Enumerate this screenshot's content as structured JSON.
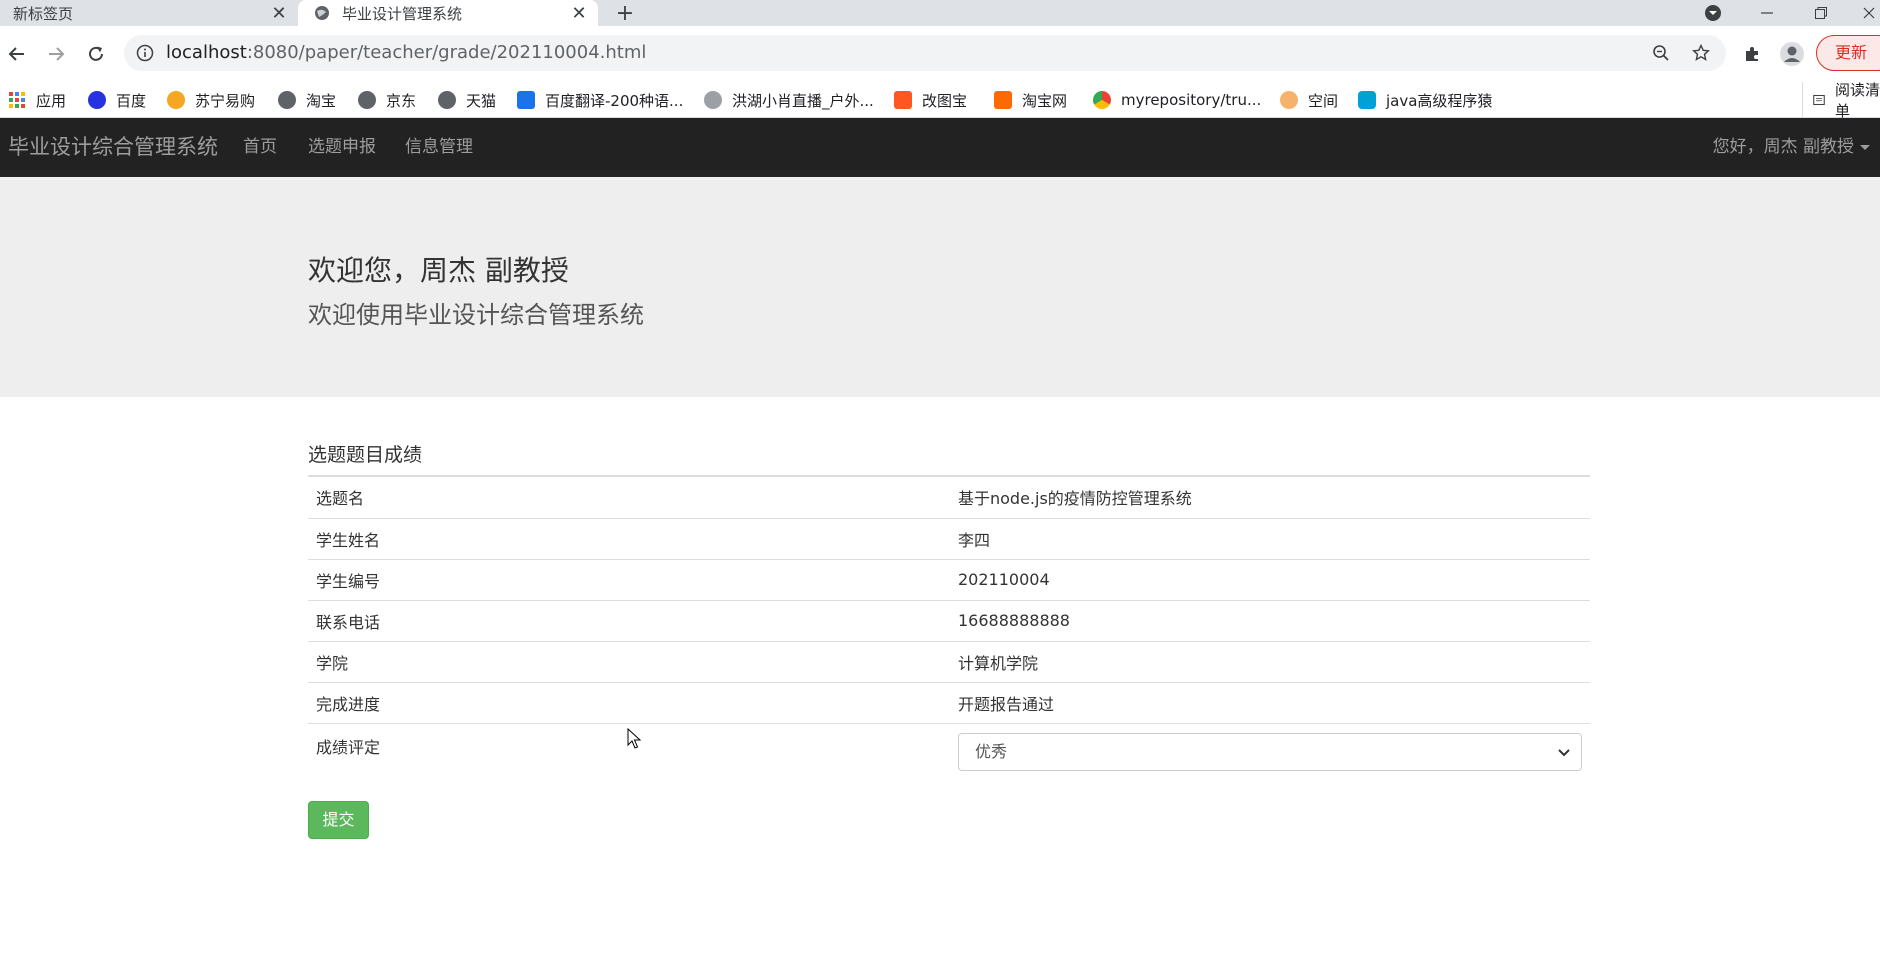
{
  "browser": {
    "tabs": [
      {
        "title": "新标签页"
      },
      {
        "title": "毕业设计管理系统"
      }
    ],
    "url_host": "localhost",
    "url_rest": ":8080/paper/teacher/grade/202110004.html",
    "update_label": "更新",
    "reading_list_label": "阅读清单",
    "bookmarks": [
      {
        "label": "应用",
        "icon": "apps-grid-icon",
        "color": "#ea4335"
      },
      {
        "label": "百度",
        "icon": "baidu-paw-icon",
        "color": "#2932e1"
      },
      {
        "label": "苏宁易购",
        "icon": "suning-icon",
        "color": "#f5a623"
      },
      {
        "label": "淘宝",
        "icon": "globe-icon",
        "color": "#5f6368"
      },
      {
        "label": "京东",
        "icon": "globe-icon",
        "color": "#5f6368"
      },
      {
        "label": "天猫",
        "icon": "globe-icon",
        "color": "#5f6368"
      },
      {
        "label": "百度翻译-200种语...",
        "icon": "translate-icon",
        "color": "#1a73e8"
      },
      {
        "label": "洪湖小肖直播_户外...",
        "icon": "bird-icon",
        "color": "#9aa0a6"
      },
      {
        "label": "改图宝",
        "icon": "gaitubao-icon",
        "color": "#ff5722"
      },
      {
        "label": "淘宝网",
        "icon": "taobao-icon",
        "color": "#ff6a00"
      },
      {
        "label": "myrepository/tru...",
        "icon": "chrome-icon",
        "color": "#34a853"
      },
      {
        "label": "空间",
        "icon": "qzone-icon",
        "color": "#f6b26b"
      },
      {
        "label": "java高级程序猿",
        "icon": "bilibili-icon",
        "color": "#00a1d6"
      }
    ]
  },
  "navbar": {
    "brand": "毕业设计综合管理系统",
    "links": [
      "首页",
      "选题申报",
      "信息管理"
    ],
    "user": "您好，周杰 副教授"
  },
  "jumbotron": {
    "title": "欢迎您，周杰 副教授",
    "subtitle": "欢迎使用毕业设计综合管理系统"
  },
  "grade": {
    "section_title": "选题题目成绩",
    "rows": [
      {
        "label": "选题名",
        "value": "基于node.js的疫情防控管理系统"
      },
      {
        "label": "学生姓名",
        "value": "李四"
      },
      {
        "label": "学生编号",
        "value": "202110004"
      },
      {
        "label": "联系电话",
        "value": "16688888888"
      },
      {
        "label": "学院",
        "value": "计算机学院"
      },
      {
        "label": "完成进度",
        "value": "开题报告通过"
      }
    ],
    "rating_label": "成绩评定",
    "rating_value": "优秀",
    "submit_label": "提交"
  },
  "colors": {
    "navbar_bg": "#222222",
    "jumbotron_bg": "#eeeeee",
    "submit_green": "#5cb85c"
  }
}
